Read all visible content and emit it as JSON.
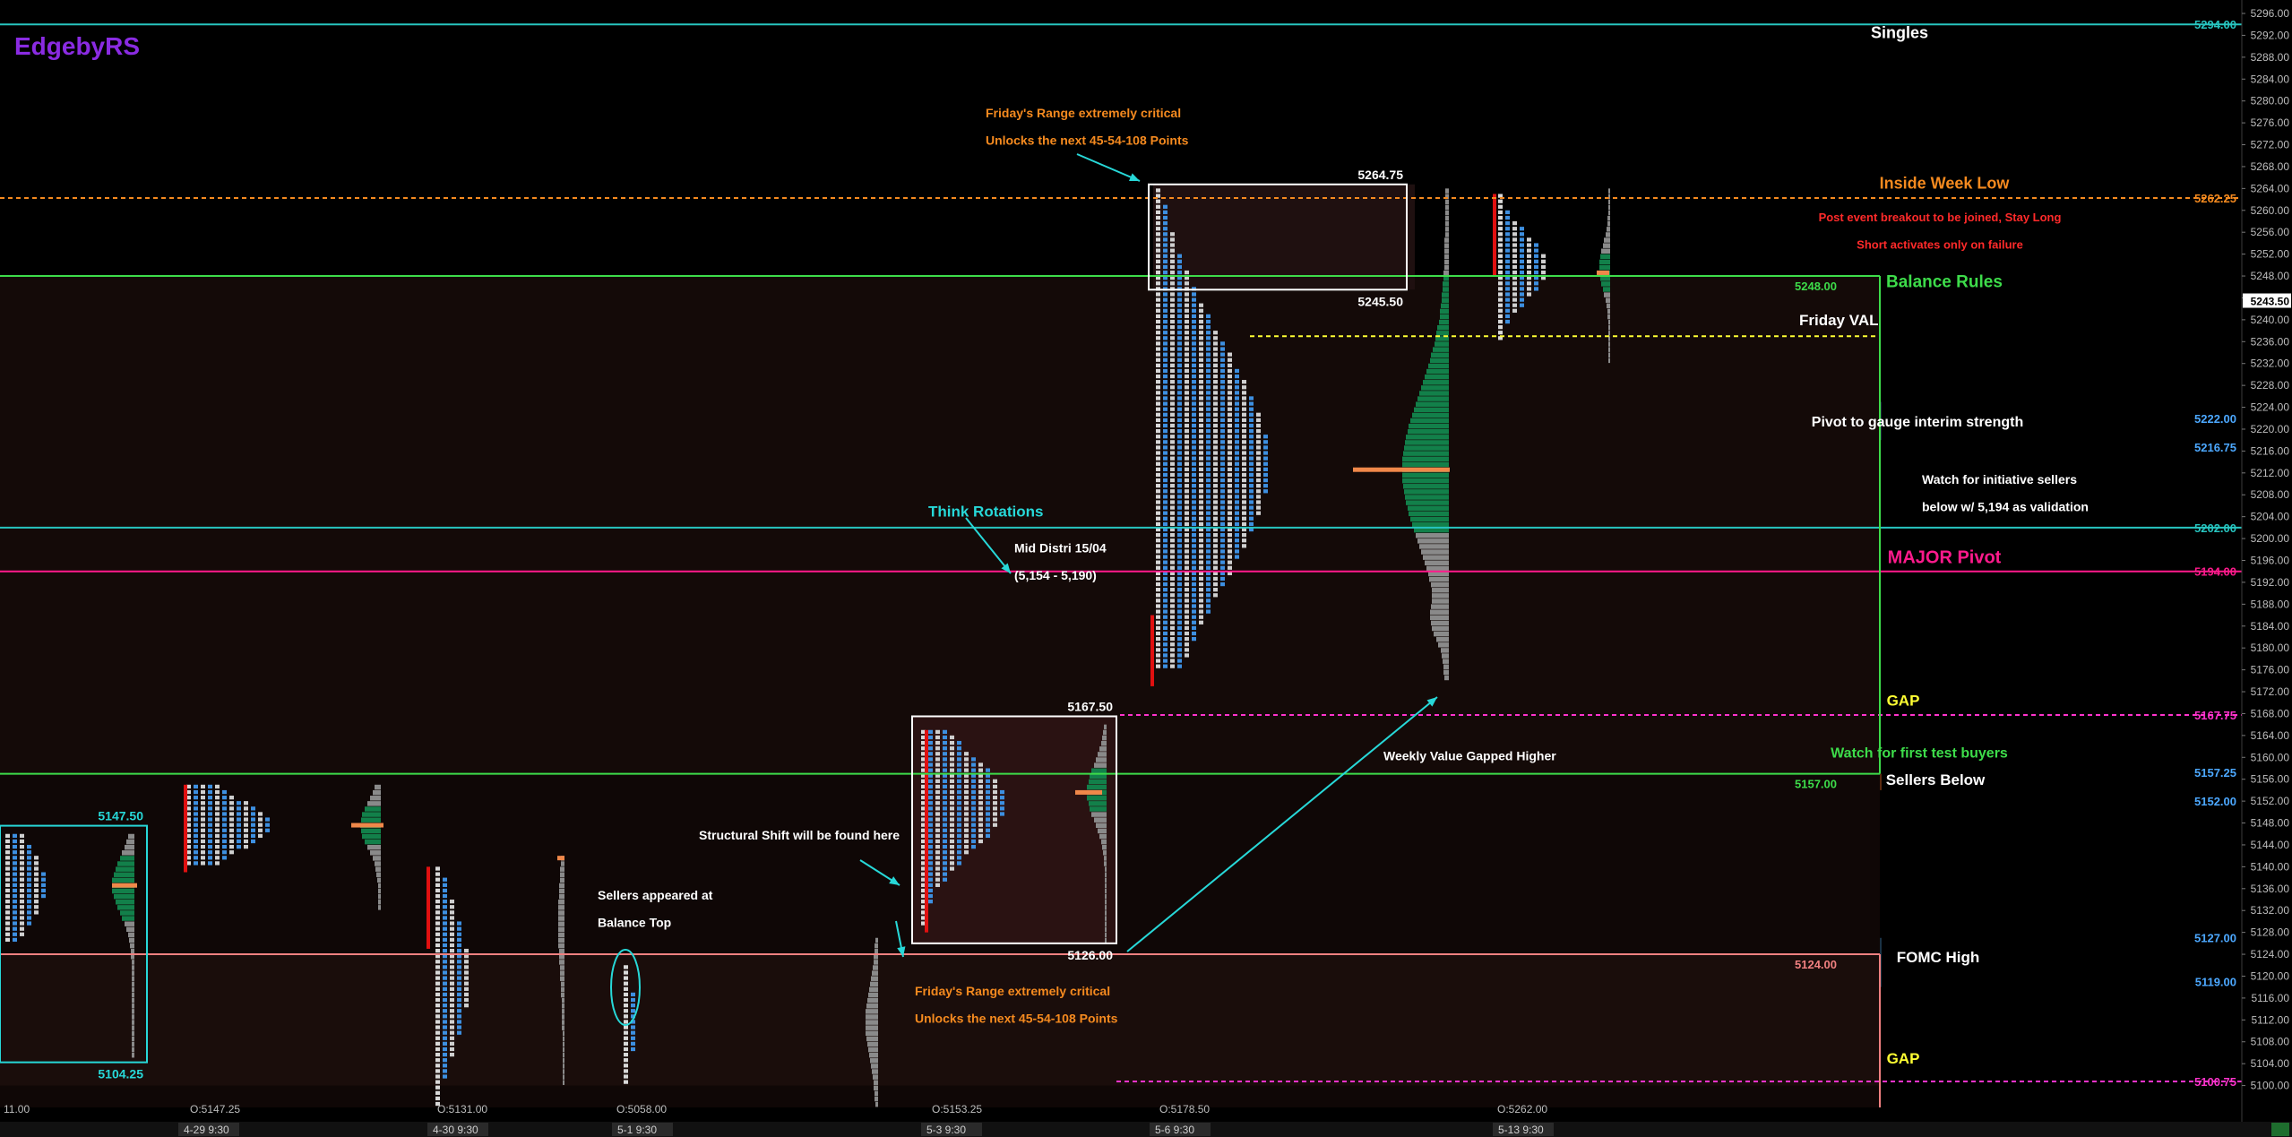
{
  "brand": "EdgebyRS",
  "chart_data": {
    "type": "market-profile",
    "y_axis": {
      "min": 5096,
      "max": 5296,
      "ticks": [
        5100,
        5104,
        5108,
        5112,
        5116,
        5120,
        5124,
        5128,
        5132,
        5136,
        5140,
        5144,
        5148,
        5152,
        5156,
        5160,
        5164,
        5168,
        5172,
        5176,
        5180,
        5184,
        5188,
        5192,
        5196,
        5200,
        5204,
        5208,
        5212,
        5216,
        5220,
        5224,
        5228,
        5232,
        5236,
        5240,
        5244,
        5248,
        5252,
        5256,
        5260,
        5264,
        5268,
        5272,
        5276,
        5280,
        5284,
        5288,
        5292,
        5296
      ]
    },
    "x_axis": {
      "labels": [
        "4-29  9:30",
        "4-30  9:30",
        "5-1  9:30",
        "5-3  9:30",
        "5-6  9:30",
        "5-13  9:30"
      ]
    },
    "level_markers": [
      {
        "label": "5294.00",
        "value": 5294.0,
        "color": "#27c5c0"
      },
      {
        "label": "5262.25",
        "value": 5262.25,
        "color": "#f58a1f"
      },
      {
        "label": "5243.50",
        "value": 5243.5,
        "color": "#ffffff"
      },
      {
        "label": "5222.00",
        "value": 5222.0,
        "color": "#4ca8ff"
      },
      {
        "label": "5216.75",
        "value": 5216.75,
        "color": "#4ca8ff"
      },
      {
        "label": "5202.00",
        "value": 5202.0,
        "color": "#27c5c0"
      },
      {
        "label": "5194.00",
        "value": 5194.0,
        "color": "#ff1a8c"
      },
      {
        "label": "5167.75",
        "value": 5167.75,
        "color": "#ff33cc"
      },
      {
        "label": "5157.25",
        "value": 5157.25,
        "color": "#4ca8ff"
      },
      {
        "label": "5152.00",
        "value": 5152.0,
        "color": "#4ca8ff"
      },
      {
        "label": "5127.00",
        "value": 5127.0,
        "color": "#4ca8ff"
      },
      {
        "label": "5119.00",
        "value": 5119.0,
        "color": "#4ca8ff"
      },
      {
        "label": "5100.75",
        "value": 5100.75,
        "color": "#ff33cc"
      }
    ],
    "levels": [
      {
        "value": 5294.0,
        "style": "solid",
        "color": "#27c5c0"
      },
      {
        "value": 5262.25,
        "style": "dashed",
        "color": "#f58a1f"
      },
      {
        "value": 5248.0,
        "style": "solid",
        "color": "#3ddc4a",
        "label": "5248.00"
      },
      {
        "value": 5237.0,
        "style": "dashed",
        "color": "#ffff33"
      },
      {
        "value": 5202.0,
        "style": "solid",
        "color": "#27c5c0"
      },
      {
        "value": 5194.0,
        "style": "solid",
        "color": "#ff1a8c"
      },
      {
        "value": 5167.75,
        "style": "dashed",
        "color": "#ff33cc"
      },
      {
        "value": 5157.0,
        "style": "solid",
        "color": "#3ddc4a",
        "label": "5157.00"
      },
      {
        "value": 5124.0,
        "style": "solid",
        "color": "#f08080",
        "label": "5124.00"
      },
      {
        "value": 5100.75,
        "style": "dashed",
        "color": "#ff33cc"
      }
    ],
    "bands": [
      {
        "from": 5218.0,
        "to": 5225.0,
        "color": "#1d2a3d"
      },
      {
        "from": 5154.0,
        "to": 5157.0,
        "color": "#5a2a10"
      },
      {
        "from": 5118.0,
        "to": 5127.0,
        "color": "#1a3245"
      }
    ],
    "boxes": [
      {
        "top": 5264.75,
        "bottom": 5245.5,
        "top_label": "5264.75",
        "bottom_label": "5245.50"
      },
      {
        "top": 5167.5,
        "bottom": 5126.0,
        "top_label": "5167.50",
        "bottom_label": "5126.00"
      },
      {
        "top": 5147.5,
        "bottom": 5104.25,
        "top_label": "5147.50",
        "bottom_label": "5104.25"
      }
    ],
    "opens": [
      "11.00",
      "O:5147.25",
      "O:5131.00",
      "O:5058.00",
      "O:5153.25",
      "O:5178.50",
      "O:5262.00"
    ],
    "annotations": [
      {
        "text": "Singles",
        "color": "#ffffff",
        "value": 5291.5
      },
      {
        "text": "Inside Week Low",
        "color": "#f58a1f",
        "value": 5264
      },
      {
        "text": "Post event breakout to be joined, Stay Long",
        "color": "#ff2a2a",
        "value": 5258
      },
      {
        "text": "Short activates only on failure",
        "color": "#ff2a2a",
        "value": 5253
      },
      {
        "text": "Balance Rules",
        "color": "#3ddc4a",
        "value": 5246
      },
      {
        "text": "Friday VAL",
        "color": "#ffffff",
        "value": 5239
      },
      {
        "text": "Pivot to gauge interim strength",
        "color": "#ffffff",
        "value": 5220.5
      },
      {
        "text": "Watch for initiative sellers",
        "color": "#ffffff",
        "value": 5210
      },
      {
        "text": "below w/ 5,194 as validation",
        "color": "#ffffff",
        "value": 5205
      },
      {
        "text": "MAJOR Pivot",
        "color": "#ff1a8c",
        "value": 5195.5
      },
      {
        "text": "GAP",
        "color": "#ffff33",
        "value": 5169.5
      },
      {
        "text": "Watch for first test buyers",
        "color": "#3ddc4a",
        "value": 5160
      },
      {
        "text": "Sellers Below",
        "color": "#ffffff",
        "value": 5155
      },
      {
        "text": "FOMC High",
        "color": "#ffffff",
        "value": 5122.5
      },
      {
        "text": "GAP",
        "color": "#ffff33",
        "value": 5104
      },
      {
        "text": "Friday's Range extremely critical",
        "color": "#f58a1f",
        "value": 5277
      },
      {
        "text": "Unlocks the next 45-54-108 Points",
        "color": "#f58a1f",
        "value": 5272
      },
      {
        "text": "Think Rotations",
        "color": "#27d8d8",
        "value": 5204
      },
      {
        "text": "Mid Distri 15/04",
        "color": "#ffffff",
        "value": 5197.5
      },
      {
        "text": "(5,154 - 5,190)",
        "color": "#ffffff",
        "value": 5192.5
      },
      {
        "text": "Weekly Value Gapped Higher",
        "color": "#ffffff",
        "value": 5159.5
      },
      {
        "text": "Structural Shift will be found here",
        "color": "#ffffff",
        "value": 5145
      },
      {
        "text": "Sellers appeared at",
        "color": "#ffffff",
        "value": 5134
      },
      {
        "text": "Balance Top",
        "color": "#ffffff",
        "value": 5129
      },
      {
        "text": "Friday's Range extremely critical",
        "color": "#f58a1f",
        "value": 5116.5
      },
      {
        "text": "Unlocks the next 45-54-108 Points",
        "color": "#f58a1f",
        "value": 5111.5
      }
    ]
  }
}
